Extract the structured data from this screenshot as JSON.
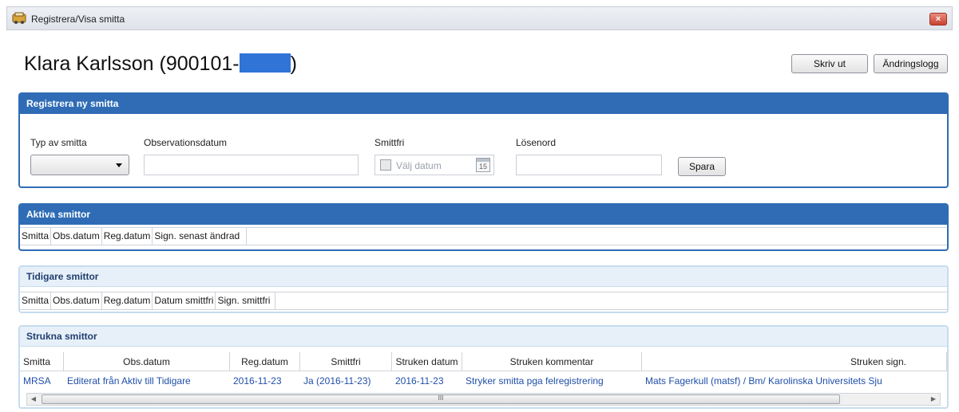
{
  "window": {
    "title": "Registrera/Visa smitta",
    "close_label": "×"
  },
  "patient": {
    "name": "Klara Karlsson (900101-",
    "suffix": ")"
  },
  "toolbar": {
    "print_label": "Skriv ut",
    "changelog_label": "Ändringslogg"
  },
  "register": {
    "title": "Registrera ny smitta",
    "type_label": "Typ av smitta",
    "type_value": "",
    "obs_date_label": "Observationsdatum",
    "obs_date_value": "",
    "free_label": "Smittfri",
    "free_placeholder": "Välj datum",
    "calendar_day": "15",
    "password_label": "Lösenord",
    "password_value": "",
    "save_label": "Spara"
  },
  "active": {
    "title": "Aktiva smittor",
    "columns": [
      "Smitta",
      "Obs.datum",
      "Reg.datum",
      "Sign. senast ändrad"
    ]
  },
  "previous": {
    "title": "Tidigare smittor",
    "columns": [
      "Smitta",
      "Obs.datum",
      "Reg.datum",
      "Datum smittfri",
      "Sign. smittfri"
    ]
  },
  "struck": {
    "title": "Strukna smittor",
    "columns": [
      "Smitta",
      "Obs.datum",
      "Reg.datum",
      "Smittfri",
      "Struken datum",
      "Struken kommentar",
      "Struken sign."
    ],
    "rows": [
      [
        "MRSA",
        "Editerat från Aktiv till Tidigare",
        "2016-11-23",
        "Ja (2016-11-23)",
        "2016-11-23",
        "Stryker smitta pga felregistrering",
        "Mats Fagerkull (matsf) / Bm/ Karolinska Universitets Sju"
      ]
    ],
    "scroll_left": "◀",
    "scroll_right": "▶",
    "scroll_grip": "III"
  }
}
